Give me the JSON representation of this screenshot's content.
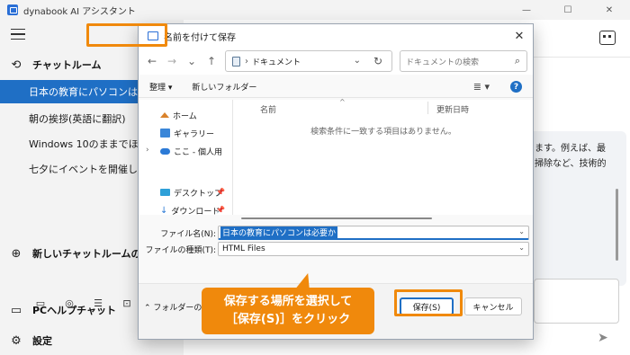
{
  "app": {
    "title": "dynabook AI アシスタント",
    "controls": {
      "minimize": "—",
      "maximize": "☐",
      "close": "✕"
    }
  },
  "sidebar": {
    "chat_room_label": "チャットルーム",
    "chats": [
      "日本の教育にパソコンは必要か",
      "朝の挨拶(英語に翻訳)",
      "Windows 10のままでほんと...",
      "七夕にイベントを開催したいと..."
    ],
    "new_chat_label": "新しいチャットルームの追加",
    "pc_help_label": "PCヘルプチャット",
    "settings_label": "設定"
  },
  "main": {
    "chat_lines": [
      "ます。例えば、最",
      "掃除など、技術的"
    ],
    "send_icon": "paper-plane"
  },
  "dialog": {
    "title": "名前を付けて保存",
    "address_path": "ドキュメント",
    "search_placeholder": "ドキュメントの検索",
    "toolbar": {
      "organize": "整理 ▾",
      "new_folder": "新しいフォルダー",
      "view": "≣ ▾",
      "help": "?"
    },
    "nav": {
      "home": "ホーム",
      "gallery": "ギャラリー",
      "personal": "ここ - 個人用",
      "desktop": "デスクトップ",
      "downloads": "ダウンロード"
    },
    "columns": {
      "name": "名前",
      "modified": "更新日時"
    },
    "empty_message": "検索条件に一致する項目はありません。",
    "filename_label": "ファイル名(N):",
    "filename_value": "日本の教育にパソコンは必要か",
    "filetype_label": "ファイルの種類(T):",
    "filetype_value": "HTML Files",
    "hide_folders": "フォルダーの非表示",
    "save_button": "保存(S)",
    "cancel_button": "キャンセル"
  },
  "callout": {
    "line1": "保存する場所を選択して",
    "line2": "［保存(S)］をクリック"
  },
  "colors": {
    "accent": "#1f6fc5",
    "highlight": "#f0890c"
  }
}
